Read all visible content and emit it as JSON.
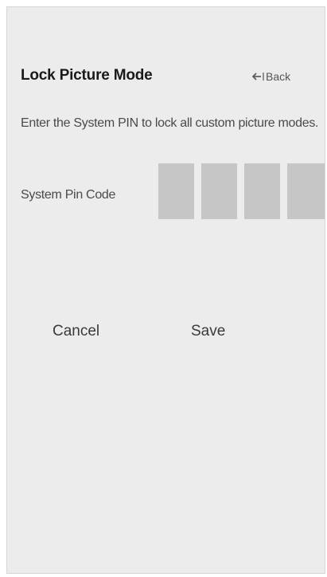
{
  "header": {
    "title": "Lock Picture Mode",
    "back_label": "Back"
  },
  "description": "Enter the System PIN to lock all custom picture modes.",
  "pin": {
    "label": "System Pin Code",
    "digits": [
      "",
      "",
      "",
      ""
    ]
  },
  "actions": {
    "cancel_label": "Cancel",
    "save_label": "Save"
  },
  "colors": {
    "panel_background": "#ececec",
    "pin_box": "#c6c6c6",
    "title_text": "#1a1a1a"
  },
  "icons": {
    "back": "back-arrow-icon"
  }
}
